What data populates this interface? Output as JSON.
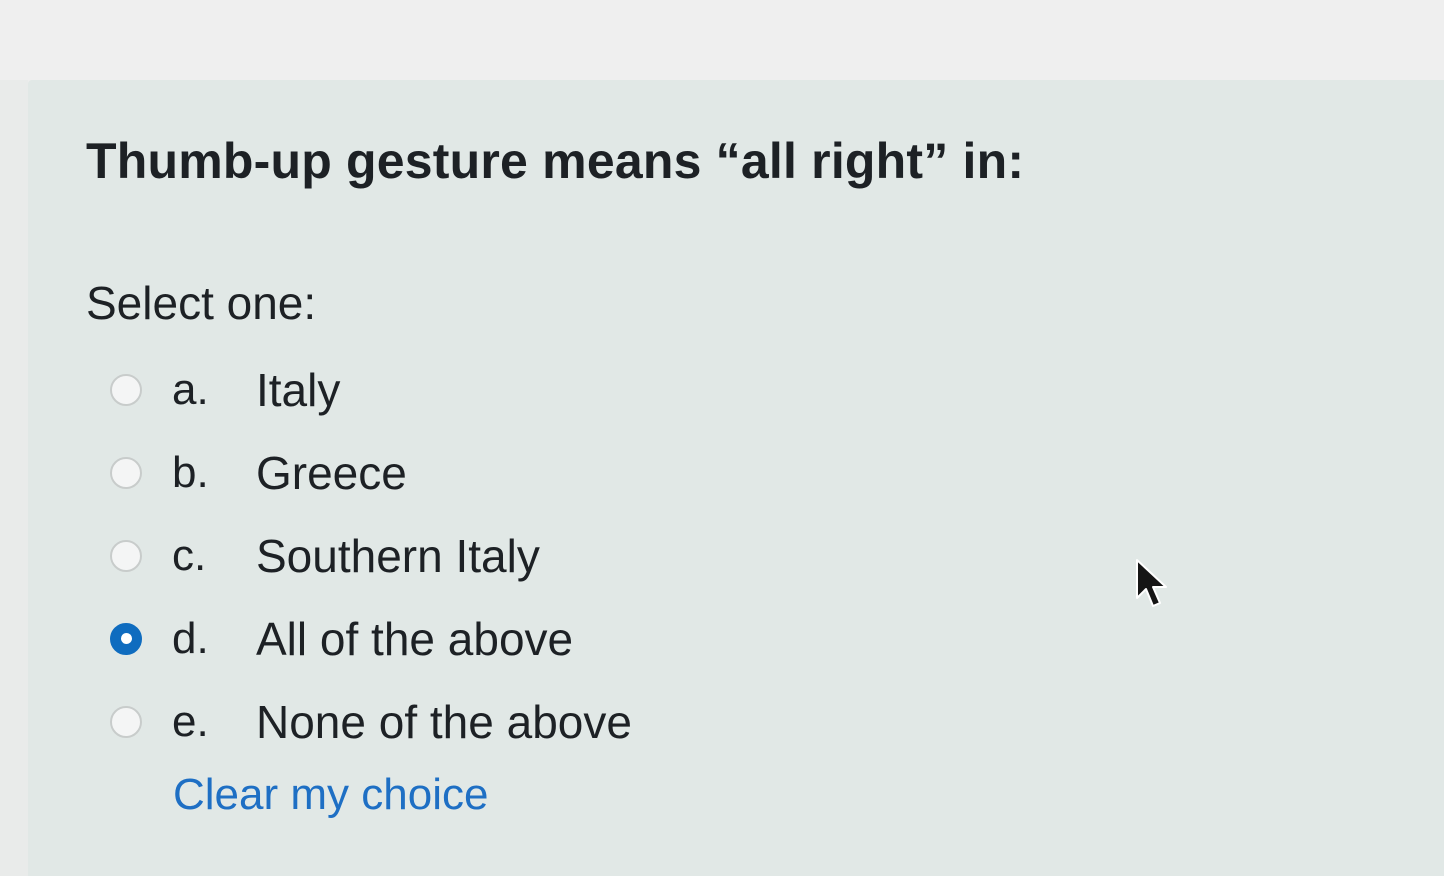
{
  "question": {
    "text": "Thumb-up gesture means “all right” in:",
    "prompt": "Select one:"
  },
  "answers": [
    {
      "letter": "a.",
      "label": "Italy",
      "selected": false
    },
    {
      "letter": "b.",
      "label": "Greece",
      "selected": false
    },
    {
      "letter": "c.",
      "label": "Southern Italy",
      "selected": false
    },
    {
      "letter": "d.",
      "label": "All of the above",
      "selected": true
    },
    {
      "letter": "e.",
      "label": "None of the above",
      "selected": false
    }
  ],
  "actions": {
    "clear_label": "Clear my choice"
  },
  "colors": {
    "accent": "#0f6cbf",
    "link": "#1e6fc4",
    "panel_background": "#e1e8e6",
    "text": "#1d2125"
  },
  "icons": {
    "cursor": "mouse-pointer-icon",
    "radio": "radio-button-icon"
  }
}
